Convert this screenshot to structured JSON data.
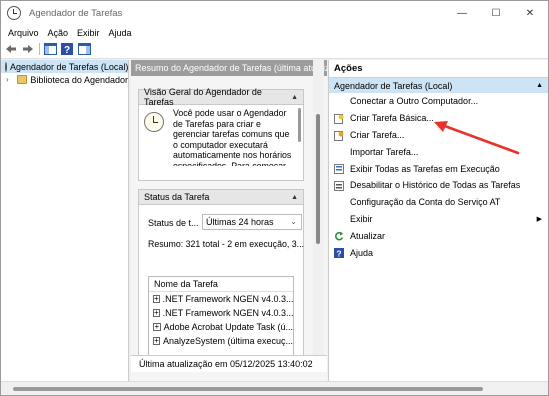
{
  "window": {
    "title": "Agendador de Tarefas",
    "min": "—",
    "max": "☐",
    "close": "✕"
  },
  "menu": [
    "Arquivo",
    "Ação",
    "Exibir",
    "Ajuda"
  ],
  "tree": {
    "root": "Agendador de Tarefas (Local)",
    "child": "Biblioteca do Agendador"
  },
  "middle": {
    "header": "Resumo do Agendador de Tarefas (última atualização",
    "overview_title": "Visão Geral do Agendador de Tarefas",
    "overview_text": "Você pode usar o Agendador de Tarefas para criar e gerenciar tarefas comuns que o computador executará automaticamente nos horários especificados. Para começar, clique em um",
    "status_title": "Status da Tarefa",
    "status_label": "Status de t...",
    "status_select": "Últimas 24 horas",
    "summary": "Resumo: 321 total - 2 em execução, 3...",
    "task_col": "Nome da Tarefa",
    "tasks": [
      ".NET Framework NGEN v4.0.3...",
      ".NET Framework NGEN v4.0.3...",
      "Adobe Acrobat Update Task (ú...",
      "AnalyzeSystem (última execuç..."
    ],
    "last_update": "Última atualização em 05/12/2025 13:40:02"
  },
  "actions": {
    "title": "Ações",
    "group": "Agendador de Tarefas (Local)",
    "items": [
      "Conectar a Outro Computador...",
      "Criar Tarefa Básica...",
      "Criar Tarefa...",
      "Importar Tarefa...",
      "Exibir Todas as Tarefas em Execução",
      "Desabilitar o Histórico de Todas as Tarefas",
      "Configuração da Conta do Serviço AT",
      "Exibir",
      "Atualizar",
      "Ajuda"
    ]
  },
  "colors": {
    "annotation_arrow": "#e8322a",
    "selection": "#cde4f7",
    "middle_header": "#9c9c9c"
  },
  "icons": [
    "task-scheduler-icon",
    "back-icon",
    "forward-icon",
    "console-tree-icon",
    "help-icon",
    "action-pane-icon",
    "folder-icon",
    "clock-icon",
    "create-basic-task-icon",
    "create-task-icon",
    "running-tasks-icon",
    "disable-history-icon",
    "refresh-icon",
    "help-icon"
  ]
}
